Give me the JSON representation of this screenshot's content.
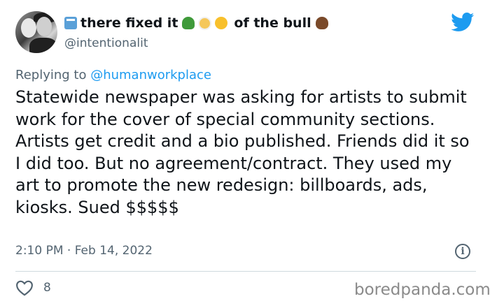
{
  "author": {
    "display_name_prefix": "there fixed it",
    "display_name_suffix": "of the bull",
    "emoji": [
      "newspaper-box-emoji",
      "turtle-emoji",
      "baby-angel-emoji",
      "sleepy-face-emoji",
      "poop-emoji"
    ],
    "handle": "@intentionalit"
  },
  "tweet": {
    "replying_label": "Replying to ",
    "replying_to": "@humanworkplace",
    "text": "Statewide newspaper was asking for artists to submit work for the cover of special community sections. Artists get credit and a bio published. Friends did it so I did too. But no agreement/contract. They used my art to promote the new redesign: billboards, ads, kiosks. Sued $$$$$",
    "timestamp": "2:10 PM · Feb 14, 2022",
    "info_icon": "i"
  },
  "actions": {
    "like_count": "8"
  },
  "watermark": "boredpanda.com",
  "colors": {
    "twitter_blue": "#1d9bf0",
    "text": "#0f1419",
    "secondary": "#536471"
  }
}
